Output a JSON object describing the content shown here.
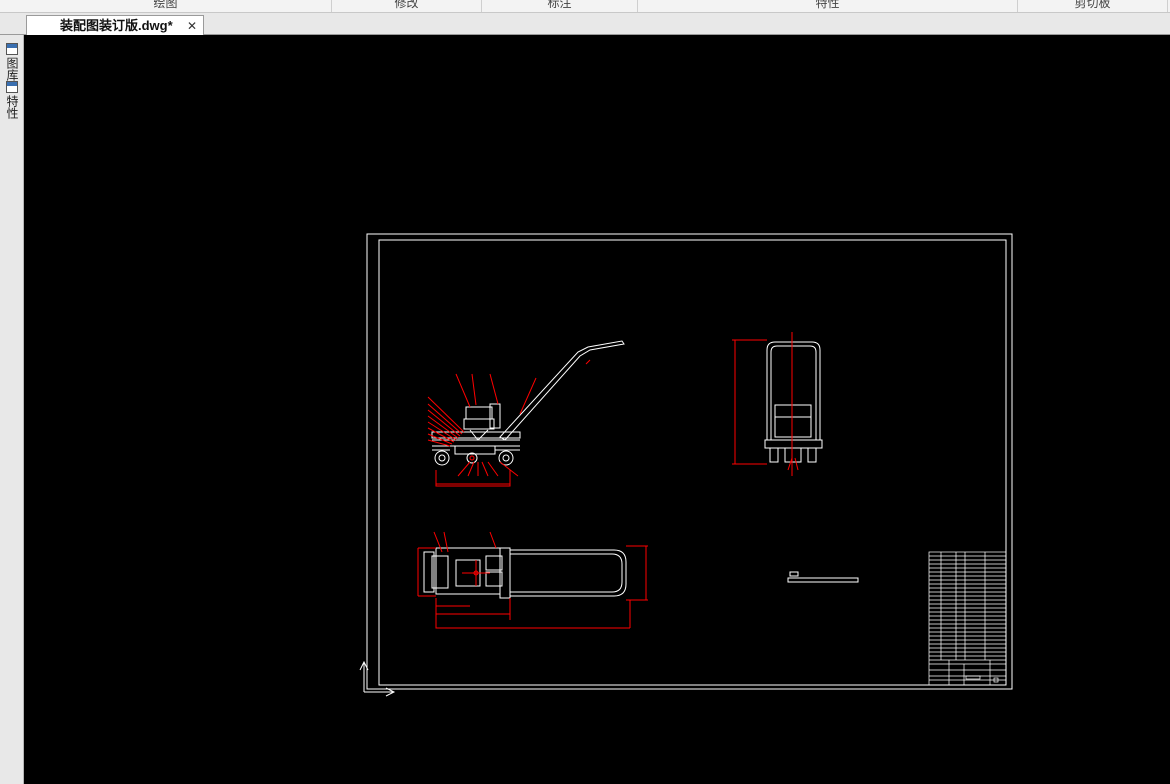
{
  "ribbon": {
    "panels": [
      "绘图",
      "修改",
      "标注",
      "特性",
      "剪切板"
    ]
  },
  "document": {
    "tab_title": "装配图装订版.dwg*",
    "close_glyph": "✕"
  },
  "left_palettes": [
    {
      "label": "图库",
      "icon": "library-icon"
    },
    {
      "label": "特性",
      "icon": "properties-icon"
    }
  ],
  "drawing": {
    "background": "#000000",
    "frame_color": "#ffffff",
    "dimension_color": "#ff0000",
    "views": [
      "front-view",
      "side-view",
      "top-view",
      "title-block-table"
    ]
  }
}
